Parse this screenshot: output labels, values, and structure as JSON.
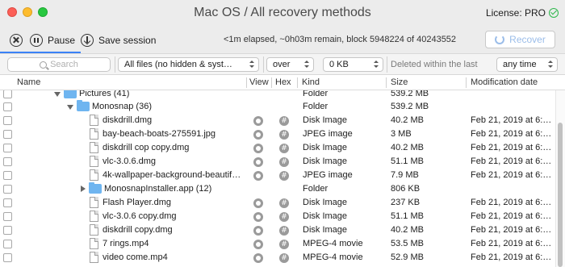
{
  "window": {
    "title": "Mac OS / All recovery methods",
    "license": "License: PRO"
  },
  "toolbar": {
    "stop_icon": "close-circle-icon",
    "pause_label": "Pause",
    "save_label": "Save session",
    "progress": "<1m elapsed, ~0h03m remain, block 5948224 of 40243552",
    "recover_label": "Recover"
  },
  "filters": {
    "search_placeholder": "Search",
    "file_filter": "All files (no hidden & syst…",
    "size_op": "over",
    "size_value": "0 KB",
    "deleted_label": "Deleted within the last",
    "deleted_range": "any time"
  },
  "columns": {
    "name": "Name",
    "view": "View",
    "hex": "Hex",
    "kind": "Kind",
    "size": "Size",
    "modified": "Modification date"
  },
  "rows": [
    {
      "name": "Pictures (41)",
      "kind": "Folder",
      "size": "539.2 MB",
      "modified": ""
    },
    {
      "name": "Monosnap (36)",
      "kind": "Folder",
      "size": "539.2 MB",
      "modified": ""
    },
    {
      "name": "diskdrill.dmg",
      "kind": "Disk Image",
      "size": "40.2 MB",
      "modified": "Feb 21, 2019 at 6:…"
    },
    {
      "name": "bay-beach-boats-275591.jpg",
      "kind": "JPEG image",
      "size": "3 MB",
      "modified": "Feb 21, 2019 at 6:…"
    },
    {
      "name": "diskdrill cop copy.dmg",
      "kind": "Disk Image",
      "size": "40.2 MB",
      "modified": "Feb 21, 2019 at 6:…"
    },
    {
      "name": "vlc-3.0.6.dmg",
      "kind": "Disk Image",
      "size": "51.1 MB",
      "modified": "Feb 21, 2019 at 6:…"
    },
    {
      "name": "4k-wallpaper-background-beautif…",
      "kind": "JPEG image",
      "size": "7.9 MB",
      "modified": "Feb 21, 2019 at 6:…"
    },
    {
      "name": "MonosnapInstaller.app (12)",
      "kind": "Folder",
      "size": "806 KB",
      "modified": ""
    },
    {
      "name": "Flash Player.dmg",
      "kind": "Disk Image",
      "size": "237 KB",
      "modified": "Feb 21, 2019 at 6:…"
    },
    {
      "name": "vlc-3.0.6 copy.dmg",
      "kind": "Disk Image",
      "size": "51.1 MB",
      "modified": "Feb 21, 2019 at 6:…"
    },
    {
      "name": "diskdrill copy.dmg",
      "kind": "Disk Image",
      "size": "40.2 MB",
      "modified": "Feb 21, 2019 at 6:…"
    },
    {
      "name": "7 rings.mp4",
      "kind": "MPEG-4 movie",
      "size": "53.5 MB",
      "modified": "Feb 21, 2019 at 6:…"
    },
    {
      "name": "video come.mp4",
      "kind": "MPEG-4 movie",
      "size": "52.9 MB",
      "modified": "Feb 21, 2019 at 6:…"
    }
  ]
}
